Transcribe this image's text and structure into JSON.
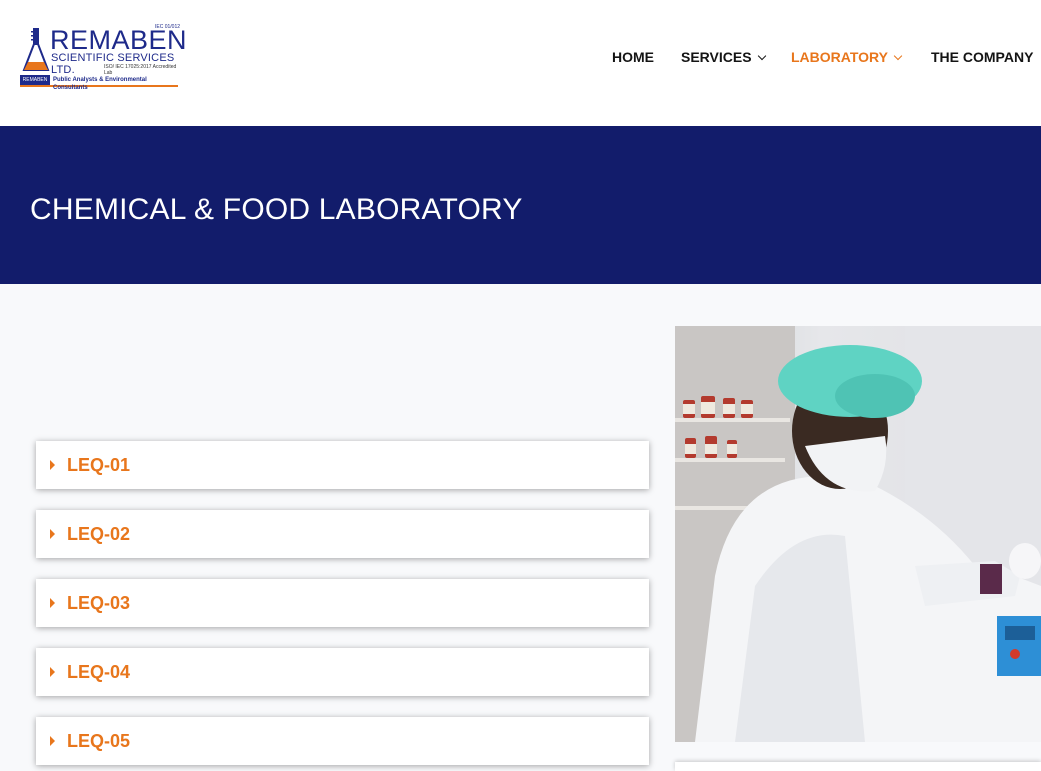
{
  "logo": {
    "brand": "REMABEN",
    "subtitle": "SCIENTIFIC SERVICES LTD.",
    "iso_line": "ISO/ IEC 17025:2017 Accredited Lab",
    "top_small": "IEC 01/012",
    "badge": "REMABEN",
    "tagline": "Public Analysts & Environmental Consultants"
  },
  "nav": {
    "items": [
      {
        "label": "HOME"
      },
      {
        "label": "SERVICES"
      },
      {
        "label": "LABORATORY"
      },
      {
        "label": "THE COMPANY"
      }
    ],
    "active": "LABORATORY"
  },
  "banner": {
    "title": "CHEMICAL & FOOD LABORATORY"
  },
  "accordion": {
    "items": [
      {
        "label": "LEQ-01"
      },
      {
        "label": "LEQ-02"
      },
      {
        "label": "LEQ-03"
      },
      {
        "label": "LEQ-04"
      },
      {
        "label": "LEQ-05"
      }
    ]
  },
  "colors": {
    "accent": "#e8761c",
    "banner": "#121c6b",
    "brand_blue": "#1e2a8a"
  },
  "icons": {
    "logo_mark": "lab-flask-icon",
    "dropdown": "chevron-down-icon",
    "accordion": "caret-right-icon"
  }
}
